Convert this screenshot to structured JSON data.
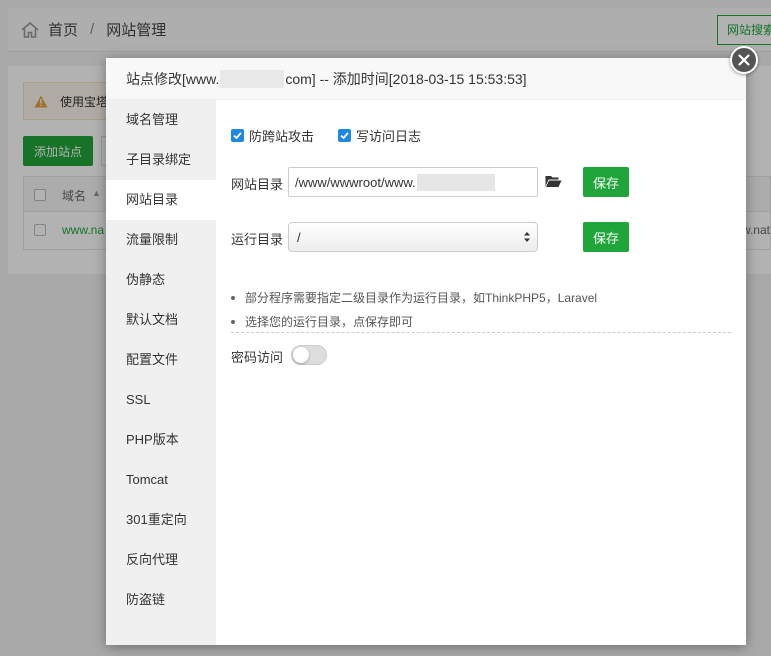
{
  "breadcrumb": {
    "home": "首页",
    "separator": "/",
    "current": "网站管理"
  },
  "toolbar": {
    "search_button": "网站搜索"
  },
  "notice": {
    "text": "使用宝塔"
  },
  "actions": {
    "add_site": "添加站点"
  },
  "table": {
    "columns": [
      "域名"
    ],
    "rows": [
      {
        "domain": "www.na",
        "domain_right": "w.nat"
      }
    ]
  },
  "modal": {
    "title_prefix": "站点修改[www.",
    "title_suffix": "com] -- 添加时间[2018-03-15 15:53:53]",
    "menu": [
      {
        "label": "域名管理",
        "active": false
      },
      {
        "label": "子目录绑定",
        "active": false
      },
      {
        "label": "网站目录",
        "active": true
      },
      {
        "label": "流量限制",
        "active": false
      },
      {
        "label": "伪静态",
        "active": false
      },
      {
        "label": "默认文档",
        "active": false
      },
      {
        "label": "配置文件",
        "active": false
      },
      {
        "label": "SSL",
        "active": false
      },
      {
        "label": "PHP版本",
        "active": false
      },
      {
        "label": "Tomcat",
        "active": false
      },
      {
        "label": "301重定向",
        "active": false
      },
      {
        "label": "反向代理",
        "active": false
      },
      {
        "label": "防盗链",
        "active": false
      }
    ],
    "checkboxes": [
      {
        "label": "防跨站攻击",
        "checked": true
      },
      {
        "label": "写访问日志",
        "checked": true
      }
    ],
    "site_dir": {
      "label": "网站目录",
      "value": "/www/wwwroot/www.",
      "save": "保存"
    },
    "run_dir": {
      "label": "运行目录",
      "value": "/",
      "save": "保存"
    },
    "tips": [
      "部分程序需要指定二级目录作为运行目录，如ThinkPHP5，Laravel",
      "选择您的运行目录，点保存即可"
    ],
    "password": {
      "label": "密码访问",
      "enabled": false
    }
  },
  "colors": {
    "accent": "#20a53a",
    "checkbox": "#1e88e5"
  }
}
